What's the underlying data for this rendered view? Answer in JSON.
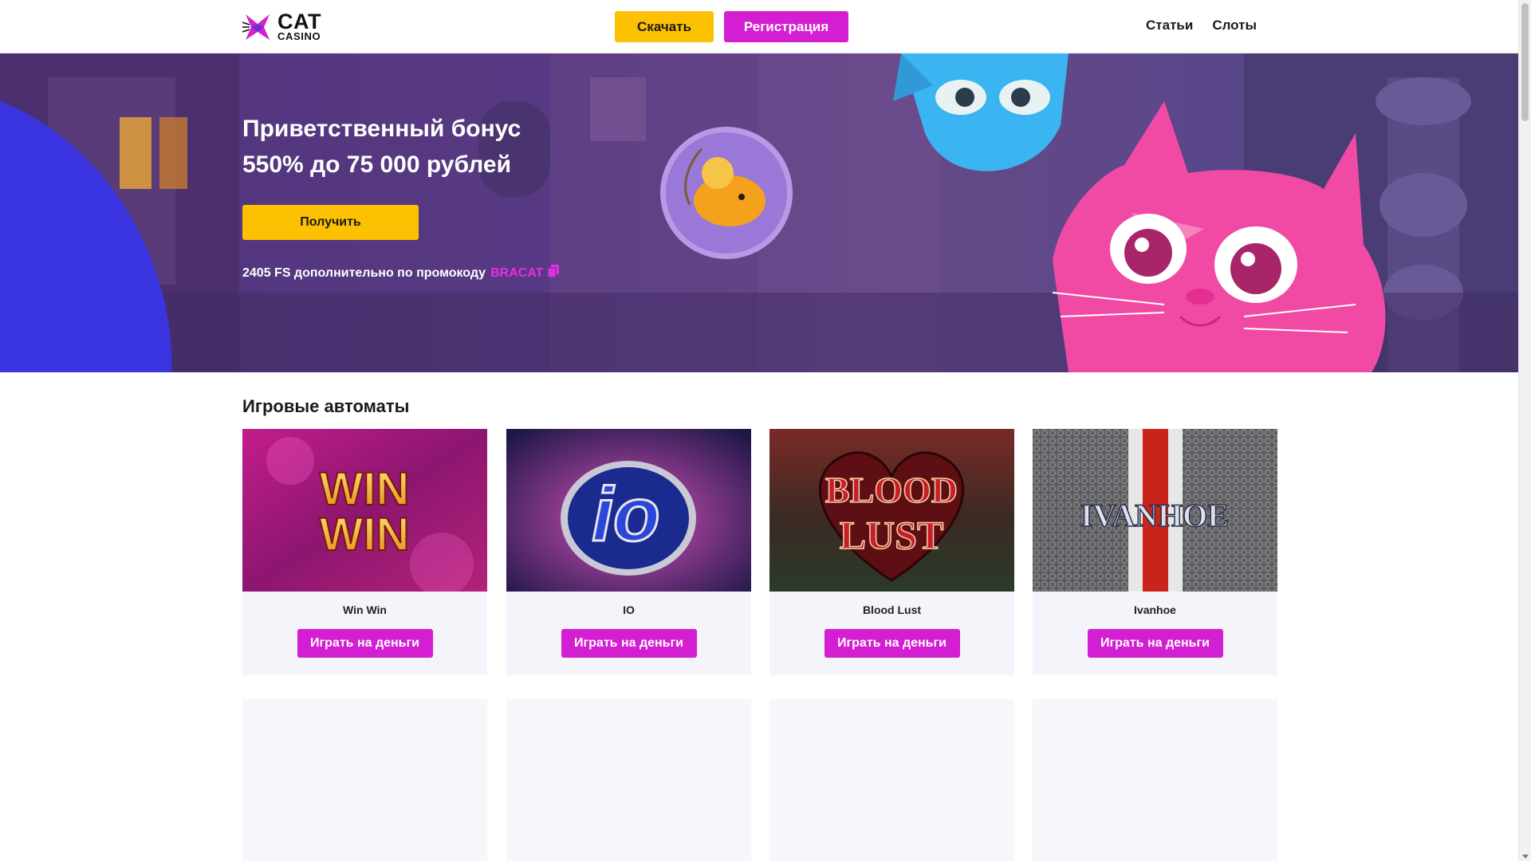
{
  "header": {
    "logo": {
      "title": "CAT",
      "subtitle": "CASINO"
    },
    "download_label": "Скачать",
    "register_label": "Регистрация",
    "nav": [
      {
        "label": "Статьи"
      },
      {
        "label": "Слоты"
      }
    ]
  },
  "hero": {
    "title_line1": "Приветственный бонус",
    "title_line2": "550% до 75 000 рублей",
    "cta_label": "Получить",
    "promo_text": "2405 FS дополнительно по промокоду",
    "promo_code": "BRACAT"
  },
  "slots": {
    "title": "Игровые автоматы",
    "play_label": "Играть на деньги",
    "games": [
      {
        "name": "Win Win",
        "logo": "WIN WIN"
      },
      {
        "name": "IO",
        "logo": "io"
      },
      {
        "name": "Blood Lust",
        "logo": "BLOOD LUST"
      },
      {
        "name": "Ivanhoe",
        "logo": "IVANHOE"
      }
    ]
  },
  "colors": {
    "accent_yellow": "#fcc100",
    "accent_magenta": "#d41ed1",
    "hero_bg": "#54337f"
  },
  "icons": [
    "cat-logo-icon",
    "copy-icon"
  ]
}
